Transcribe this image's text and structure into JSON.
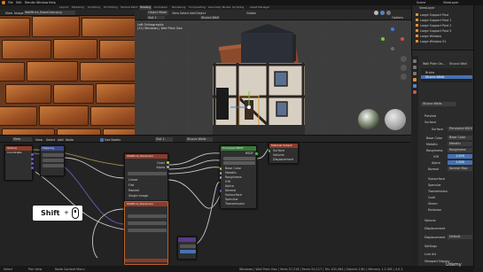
{
  "topbar": {
    "menus": [
      "File",
      "Edit",
      "Render",
      "Window",
      "Help"
    ],
    "scene_label": "Scene",
    "view_layer_label": "ViewLayer"
  },
  "workspaces": [
    "Layout",
    "Modeling",
    "Sculpting",
    "UV Editing",
    "Texture Paint",
    "Shading",
    "Animation",
    "Rendering",
    "Compositing",
    "Geometry Nodes",
    "Scripting",
    "Asset Manager"
  ],
  "active_workspace": "Shading",
  "image_editor": {
    "view_label": "View",
    "image_label": "Image",
    "image_name": "WallBrick_BaseColor.png"
  },
  "viewport": {
    "mode": "Object Mode",
    "menus": [
      "View",
      "Select",
      "Add",
      "Object"
    ],
    "orientation": "Global",
    "slot_label": "Slot 1",
    "material_label": "Stucco Wall",
    "info_line1": "Left Orthographic",
    "info_line2": "(21) Windows | Wall Plain Geo",
    "options_label": "Options"
  },
  "outliner": {
    "title": "ViewLayer",
    "items": [
      "Large Support Post",
      "Large Support Post 1",
      "Large Support Post 2",
      "Large Support Post 3",
      "Large Window",
      "Large Window 01"
    ]
  },
  "properties": {
    "object_name": "Wall Plain Ge...",
    "material_name": "Stucco Wall",
    "slots": [
      "Bricks",
      "Stucco Walls"
    ],
    "mat_field": "Stucco Walls",
    "sections": [
      "Preview",
      "Surface"
    ],
    "surface_label": "Surface",
    "surface_value": "Principled BSDF",
    "rows": [
      {
        "label": "Base Color",
        "value": "Base Color"
      },
      {
        "label": "Metallic",
        "value": "Metallic"
      },
      {
        "label": "Roughness",
        "value": "Roughness"
      },
      {
        "label": "IOR",
        "value": "1.500"
      },
      {
        "label": "Alpha",
        "value": "1.000"
      },
      {
        "label": "Normal",
        "value": "Normal Map"
      }
    ],
    "subsections": [
      "Subsurface",
      "Specular",
      "Transmission",
      "Coat",
      "Sheen",
      "Emission"
    ],
    "volume_label": "Volume",
    "displacement_header": "Displacement",
    "displacement_label": "Displacement",
    "displacement_value": "Default",
    "settings": [
      "Settings",
      "Line Art",
      "Viewport Display"
    ]
  },
  "node_editor": {
    "menus": [
      "View",
      "Select",
      "Add",
      "Node"
    ],
    "use_nodes_label": "Use Nodes",
    "slot_label": "Slot 1",
    "material_label": "Stucco Walls",
    "tree_label": "Stucco Walls"
  },
  "nodes": {
    "texcoord": {
      "title": "Texture Coordinate"
    },
    "image": {
      "title": "WallBrick_BaseColor",
      "rows": [
        "Color",
        "Alpha",
        "Linear",
        "Flat",
        "Repeat",
        "Single Image"
      ]
    },
    "mapping": {
      "title": "Mapping"
    },
    "bsdf": {
      "title": "Principled BSDF",
      "rows": [
        "BSDF",
        "Base Color",
        "Metallic",
        "Roughness",
        "IOR",
        "Alpha",
        "Normal",
        "Subsurface",
        "Specular",
        "Transmission",
        "Coat",
        "Sheen",
        "Emission"
      ]
    },
    "output": {
      "title": "Material Output",
      "rows": [
        "All",
        "Surface",
        "Volume",
        "Displacement"
      ]
    }
  },
  "keypress": {
    "label": "Shift",
    "mouse_icon": "mouse-icon"
  },
  "status": {
    "items": [
      "Select",
      "Pan View",
      "Node Context Menu"
    ],
    "right": "Windows | Wall Plain Geo | Verts 57,218 | Faces 50,117 | Tris 100,584 | Objects 1/61 | Memory 1.2 GiB | 4.0.2"
  },
  "watermark": "Udemy"
}
